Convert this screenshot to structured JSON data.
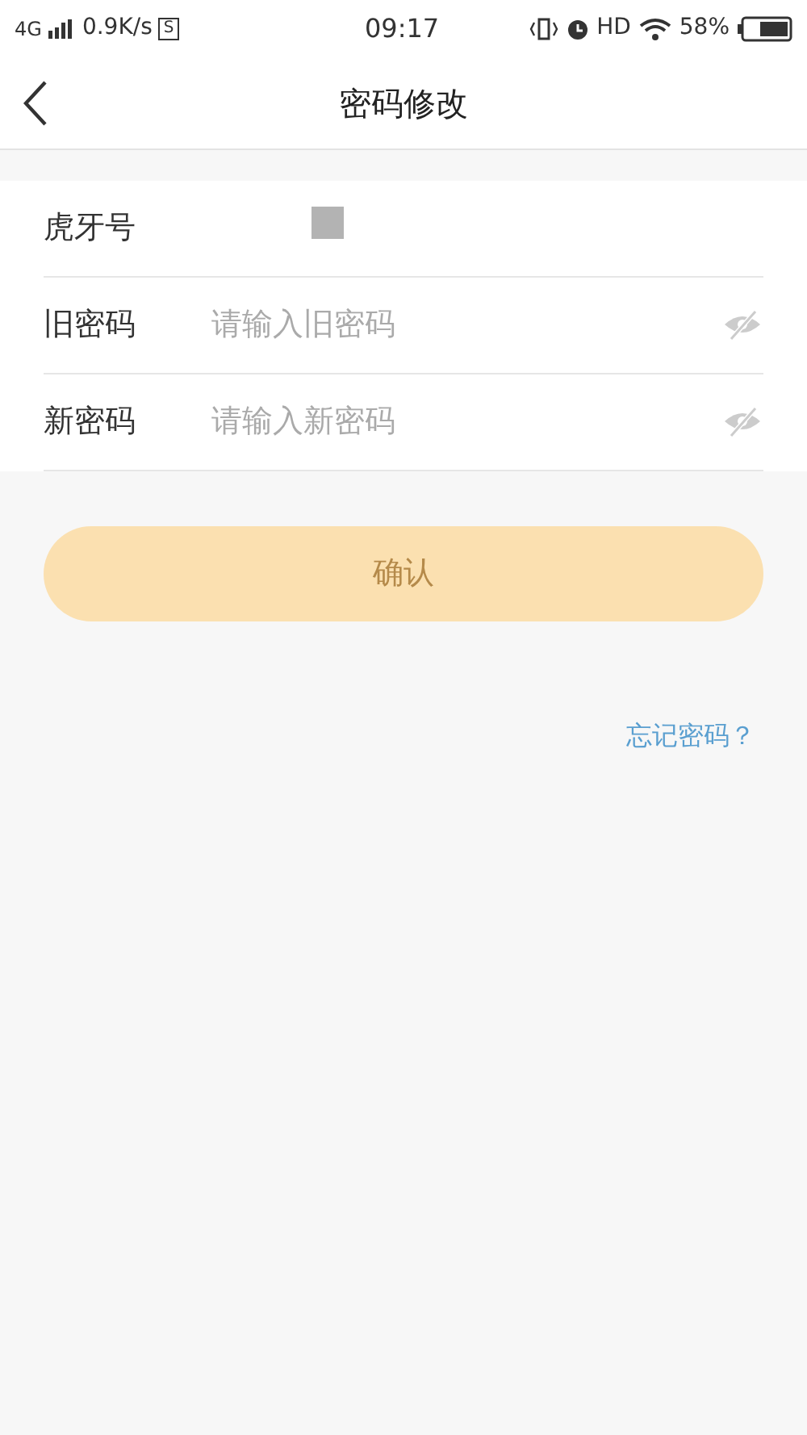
{
  "status_bar": {
    "network": "4G",
    "speed": "0.9K/s",
    "badge": "S",
    "time": "09:17",
    "hd": "HD",
    "battery": "58%"
  },
  "header": {
    "title": "密码修改"
  },
  "fields": [
    {
      "kind": "account",
      "label": "虎牙号",
      "redacted": true
    },
    {
      "kind": "password",
      "label": "旧密码",
      "placeholder": "请输入旧密码",
      "visible": false
    },
    {
      "kind": "password",
      "label": "新密码",
      "placeholder": "请输入新密码",
      "visible": false
    }
  ],
  "confirm_button": {
    "label": "确认",
    "disabled": true
  },
  "forgot_link": "忘记密码？"
}
